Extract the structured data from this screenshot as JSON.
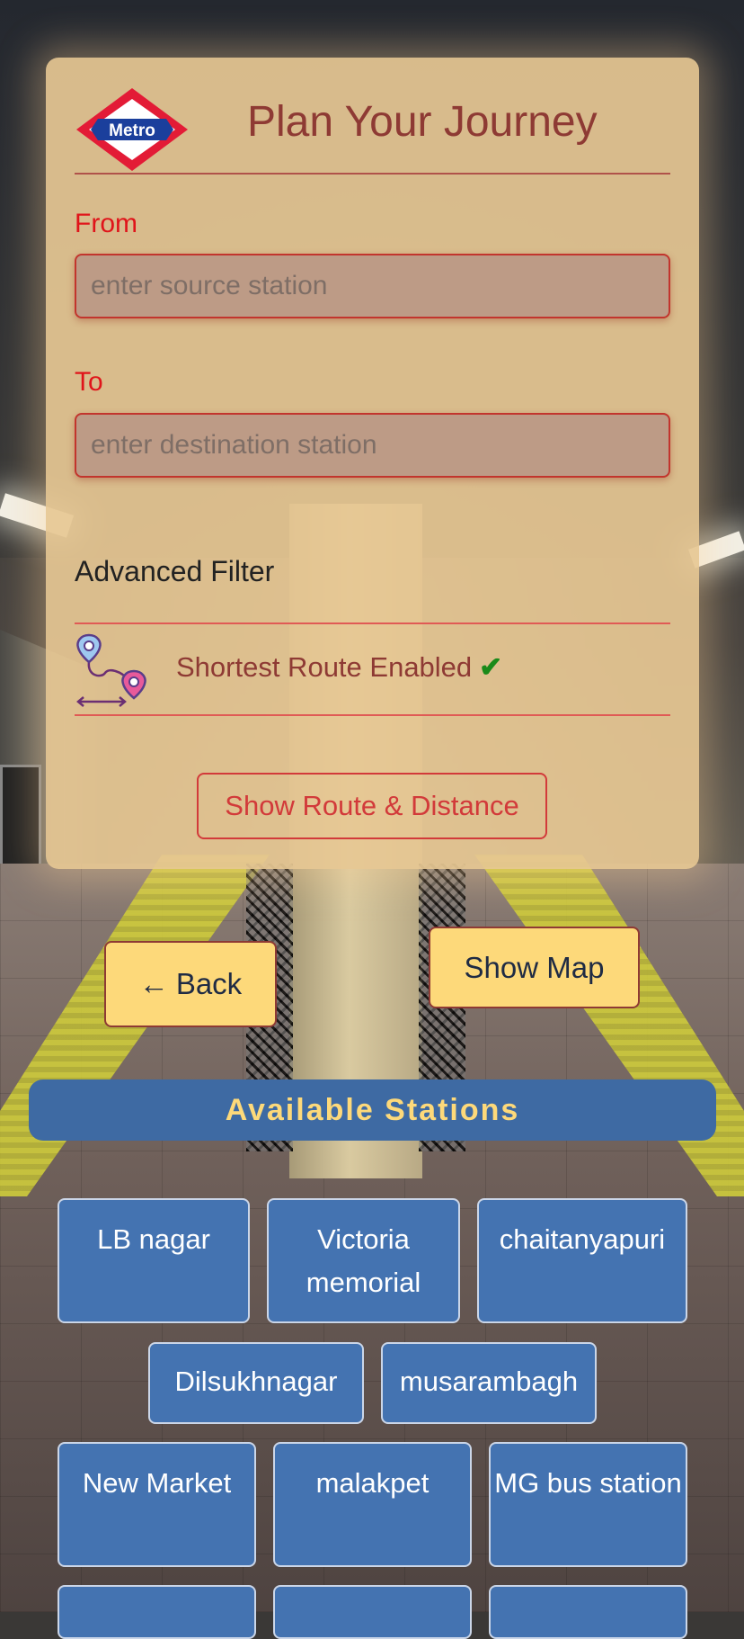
{
  "header": {
    "title": "Plan Your Journey",
    "logo_text": "Metro"
  },
  "form": {
    "from_label": "From",
    "from_placeholder": "enter source station",
    "to_label": "To",
    "to_placeholder": "enter destination station",
    "advanced_filter_label": "Advanced Filter",
    "filter_text": "Shortest Route Enabled",
    "filter_check_icon": "check-icon",
    "show_route_label": "Show Route & Distance"
  },
  "actions": {
    "back_label": "Back",
    "back_icon": "arrow-left-icon",
    "show_map_label": "Show Map"
  },
  "stations": {
    "title": "Available Stations",
    "items": [
      {
        "label": "LB nagar"
      },
      {
        "label": "Victoria memorial"
      },
      {
        "label": "chaitanyapuri"
      },
      {
        "label": "Dilsukhnagar"
      },
      {
        "label": "musarambagh"
      },
      {
        "label": "New Market"
      },
      {
        "label": "malakpet"
      },
      {
        "label": "MG bus station"
      }
    ]
  },
  "colors": {
    "card_bg": "#e7c894",
    "title": "#8e3a34",
    "label_red": "#e0141a",
    "input_bg": "#bd9b86",
    "button_yellow": "#fdd97a",
    "station_blue": "#4473b1",
    "check_green": "#1a8a1a"
  }
}
